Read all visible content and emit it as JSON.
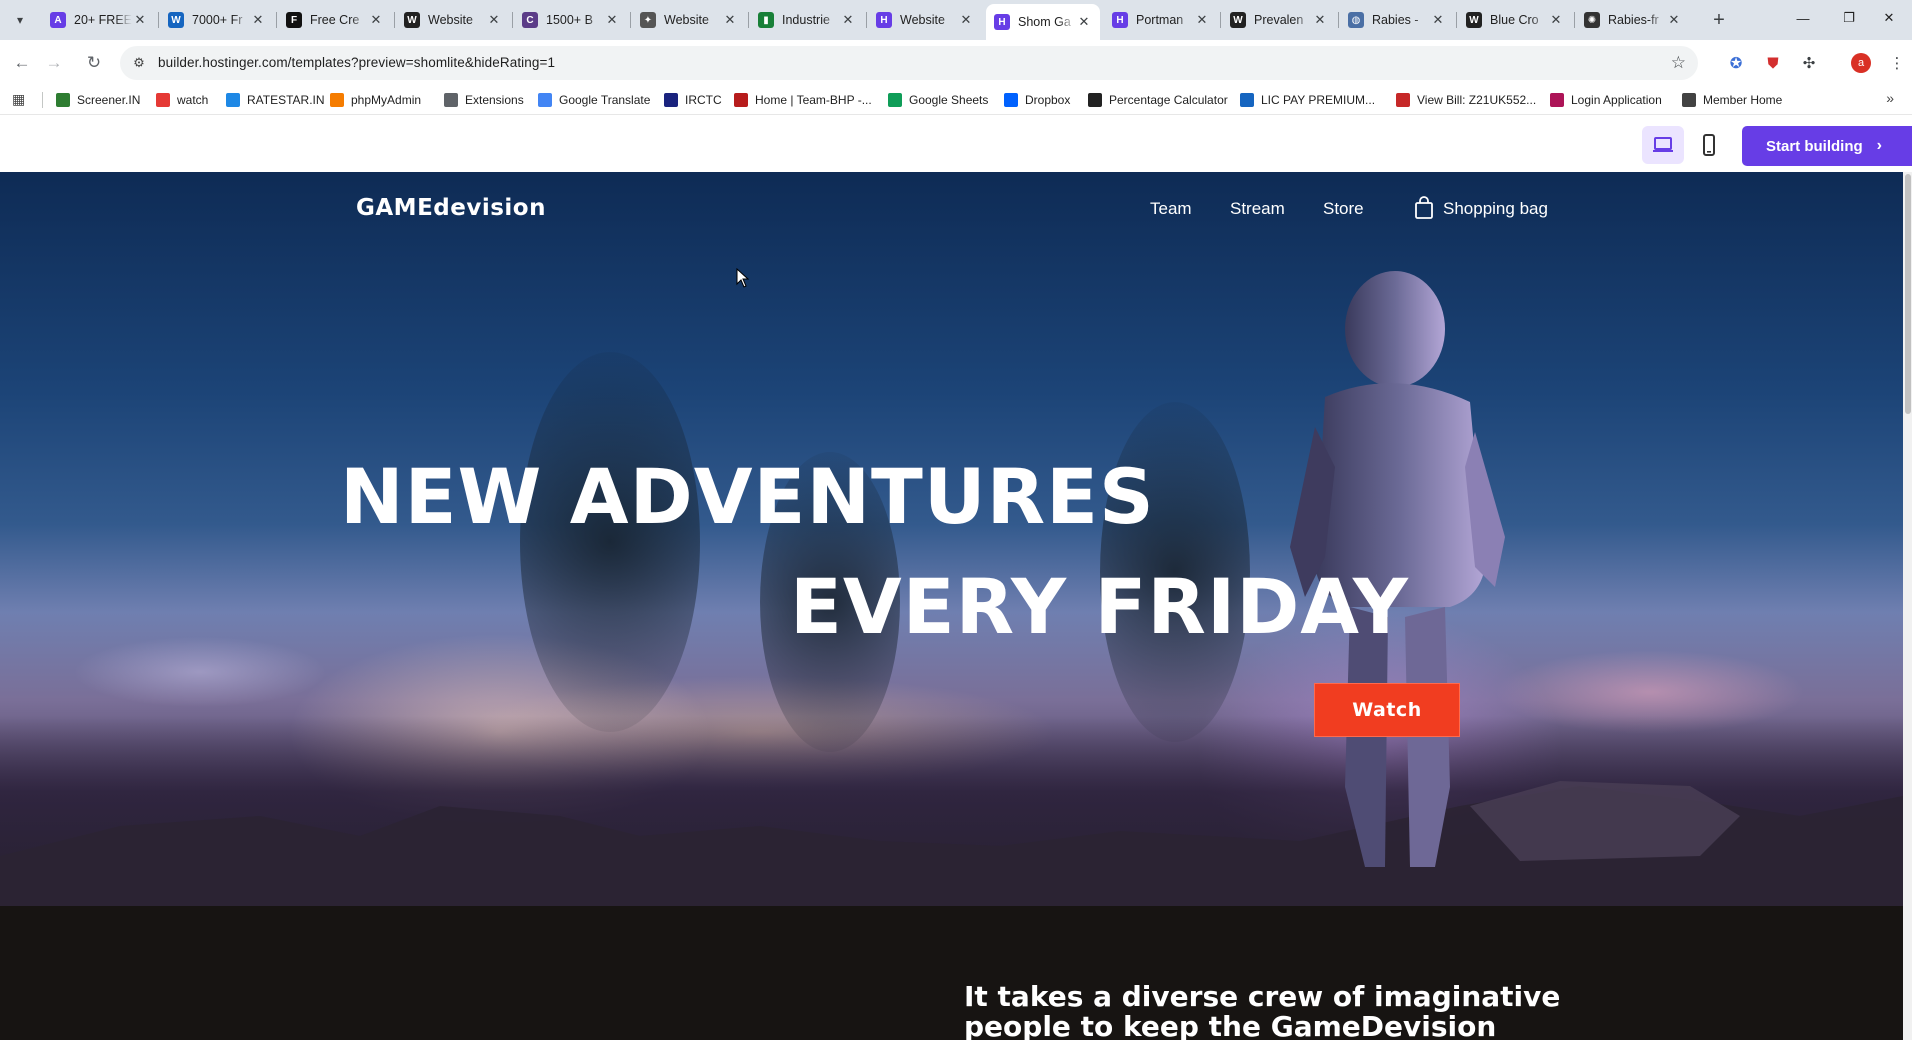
{
  "browser": {
    "tabs": [
      {
        "title": "20+ FREE",
        "favicon": "a-icon",
        "color": "#673de6"
      },
      {
        "title": "7000+ Fr",
        "favicon": "w-icon",
        "color": "#1565c0"
      },
      {
        "title": "Free Cre",
        "favicon": "framer-icon",
        "color": "#111111"
      },
      {
        "title": "Website",
        "favicon": "wix-icon",
        "color": "#222222"
      },
      {
        "title": "1500+ B",
        "favicon": "colorlib-icon",
        "color": "#5b3c88"
      },
      {
        "title": "Website",
        "favicon": "webflow-icon",
        "color": "#555555"
      },
      {
        "title": "Industrie",
        "favicon": "chart-icon",
        "color": "#188038"
      },
      {
        "title": "Website",
        "favicon": "hostinger-icon",
        "color": "#673de6"
      },
      {
        "title": "Shom Ga",
        "favicon": "hostinger-icon",
        "color": "#673de6",
        "active": true
      },
      {
        "title": "Portman",
        "favicon": "hostinger-icon",
        "color": "#673de6"
      },
      {
        "title": "Prevalen",
        "favicon": "wikipedia-icon",
        "color": "#222222"
      },
      {
        "title": "Rabies -",
        "favicon": "globe-icon",
        "color": "#4a6fa5"
      },
      {
        "title": "Blue Cro",
        "favicon": "wikipedia-icon",
        "color": "#222222"
      },
      {
        "title": "Rabies-fr",
        "favicon": "openai-icon",
        "color": "#333333"
      }
    ],
    "url": "builder.hostinger.com/templates?preview=shomlite&hideRating=1",
    "profile_initial": "a",
    "bookmarks": [
      {
        "label": "Screener.IN",
        "color": "#2e7d32"
      },
      {
        "label": "watch",
        "color": "#e53935"
      },
      {
        "label": "RATESTAR.IN",
        "color": "#1e88e5"
      },
      {
        "label": "phpMyAdmin",
        "color": "#f57c00"
      },
      {
        "label": "Extensions",
        "color": "#5f6368"
      },
      {
        "label": "Google Translate",
        "color": "#4285f4"
      },
      {
        "label": "IRCTC",
        "color": "#1a237e"
      },
      {
        "label": "Home | Team-BHP -...",
        "color": "#b71c1c"
      },
      {
        "label": "Google Sheets",
        "color": "#0f9d58"
      },
      {
        "label": "Dropbox",
        "color": "#0061fe"
      },
      {
        "label": "Percentage Calculator",
        "color": "#222222"
      },
      {
        "label": "LIC PAY PREMIUM...",
        "color": "#1565c0"
      },
      {
        "label": "View Bill: Z21UK552...",
        "color": "#c62828"
      },
      {
        "label": "Login Application",
        "color": "#ad1457"
      },
      {
        "label": "Member Home",
        "color": "#424242"
      }
    ]
  },
  "builder": {
    "start_label": "Start building"
  },
  "site": {
    "brand": "GAMEdevision",
    "nav": [
      "Team",
      "Stream",
      "Store"
    ],
    "bag_label": "Shopping bag",
    "headline_line1": "NEW ADVENTURES",
    "headline_line2": "EVERY FRIDAY",
    "watch_label": "Watch",
    "crew_text": "It takes a diverse crew of imaginative people to keep the GameDevision"
  }
}
